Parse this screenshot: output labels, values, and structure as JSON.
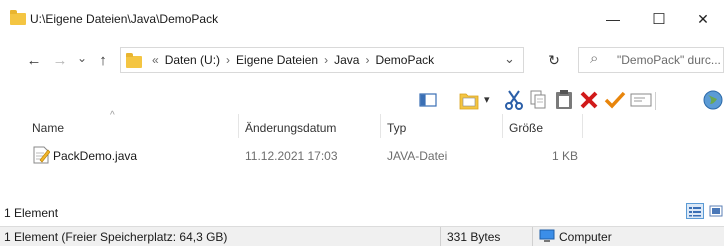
{
  "window": {
    "title": "U:\\Eigene Dateien\\Java\\DemoPack",
    "minimize_glyph": "—",
    "maximize_glyph": "☐",
    "close_glyph": "✕"
  },
  "nav": {
    "back_glyph": "←",
    "forward_glyph": "→",
    "recent_glyph": "⌄",
    "up_glyph": "↑",
    "overflow_glyph": "«",
    "breadcrumbs": [
      "Daten (U:)",
      "Eigene Dateien",
      "Java",
      "DemoPack"
    ],
    "separator": "›",
    "dropdown_glyph": "⌄",
    "refresh_glyph": "↻"
  },
  "search": {
    "icon_glyph": "⌕",
    "placeholder": "\"DemoPack\" durc..."
  },
  "toolbar": {
    "icons": [
      "view-pane-icon",
      "properties-icon",
      "cut-icon",
      "copy-icon",
      "paste-icon",
      "delete-icon",
      "checkmark-icon",
      "rename-icon",
      "globe-icon"
    ],
    "dropdown_glyph": "▾"
  },
  "columns": {
    "name": "Name",
    "date": "Änderungsdatum",
    "type": "Typ",
    "size": "Größe",
    "sort_glyph": "^"
  },
  "files": [
    {
      "name": "PackDemo.java",
      "date": "11.12.2021 17:03",
      "type": "JAVA-Datei",
      "size": "1 KB"
    }
  ],
  "status": {
    "count": "1 Element",
    "detail": "1 Element (Freier Speicherplatz: 64,3 GB)",
    "bytes": "331 Bytes",
    "computer": "Computer"
  },
  "colors": {
    "folder": "#f4c542",
    "delete": "#d11a1a",
    "check": "#e8850c",
    "statusbar_bg": "#f0f0f0"
  }
}
